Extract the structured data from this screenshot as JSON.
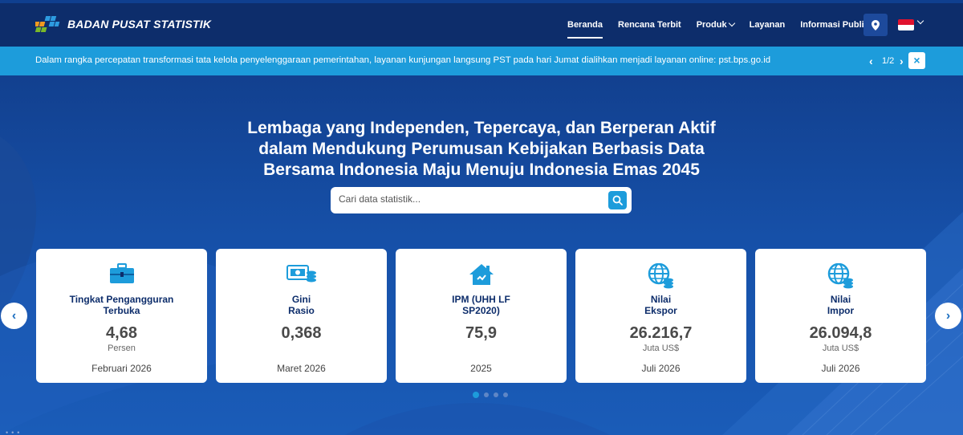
{
  "header": {
    "brand": "BADAN PUSAT STATISTIK",
    "nav": [
      {
        "label": "Beranda",
        "active": true,
        "dropdown": false
      },
      {
        "label": "Rencana Terbit",
        "active": false,
        "dropdown": false
      },
      {
        "label": "Produk",
        "active": false,
        "dropdown": true
      },
      {
        "label": "Layanan",
        "active": false,
        "dropdown": false
      },
      {
        "label": "Informasi Publik",
        "active": false,
        "dropdown": true
      }
    ],
    "location_icon": "map-pin-icon",
    "language_flag": "indonesia-flag"
  },
  "announcement": {
    "text": "Dalam rangka percepatan transformasi tata kelola penyelenggaraan pemerintahan, layanan kunjungan langsung PST pada hari Jumat dialihkan menjadi layanan online: pst.bps.go.id",
    "counter": "1/2",
    "prev": "‹",
    "next": "›",
    "close": "×"
  },
  "hero": {
    "headline_lines": [
      "Lembaga yang Independen, Tepercaya, dan Berperan Aktif",
      "dalam Mendukung Perumusan Kebijakan Berbasis Data",
      "Bersama Indonesia Maju Menuju Indonesia Emas 2045"
    ],
    "search_placeholder": "Cari data statistik..."
  },
  "cards": [
    {
      "icon": "briefcase-icon",
      "title_lines": [
        "Tingkat Pengangguran",
        "Terbuka"
      ],
      "value": "4,68",
      "unit": "Persen",
      "period": "Februari 2026"
    },
    {
      "icon": "money-coins-icon",
      "title_lines": [
        "Gini",
        "Rasio"
      ],
      "value": "0,368",
      "unit": "",
      "period": "Maret 2026"
    },
    {
      "icon": "house-icon",
      "title_lines": [
        "IPM (UHH LF",
        "SP2020)"
      ],
      "value": "75,9",
      "unit": "",
      "period": "2025"
    },
    {
      "icon": "globe-coins-icon",
      "title_lines": [
        "Nilai",
        "Ekspor"
      ],
      "value": "26.216,7",
      "unit": "Juta US$",
      "period": "Juli 2026"
    },
    {
      "icon": "globe-coins-icon",
      "title_lines": [
        "Nilai",
        "Impor"
      ],
      "value": "26.094,8",
      "unit": "Juta US$",
      "period": "Juli 2026"
    }
  ],
  "carousel": {
    "prev": "‹",
    "next": "›",
    "dot_count": 4,
    "active_dot": 0
  },
  "colors": {
    "nav_bg": "#0d2d6b",
    "announce_bg": "#1d9cdb",
    "card_title": "#0d2d6b",
    "accent": "#1d9cdb"
  }
}
